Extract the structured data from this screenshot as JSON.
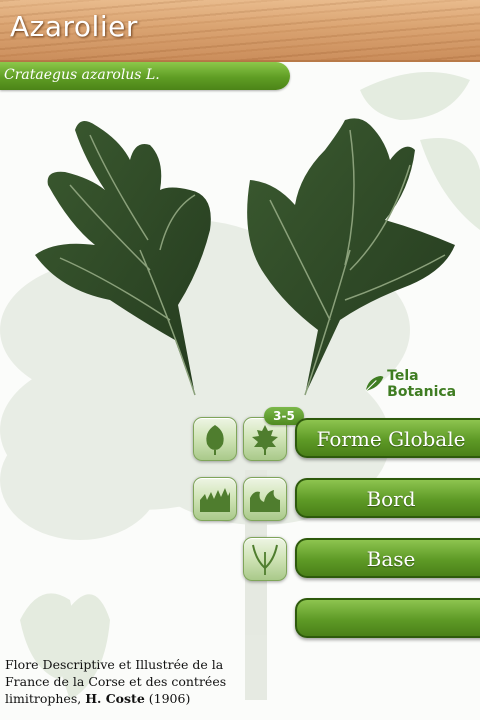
{
  "header": {
    "title": "Azarolier"
  },
  "species": {
    "scientific_name": "Crataegus azarolus L."
  },
  "logo": {
    "text": "Tela Botanica"
  },
  "criteria": {
    "badge": "3-5",
    "buttons": [
      {
        "label": "Forme Globale"
      },
      {
        "label": "Bord"
      },
      {
        "label": "Base"
      },
      {
        "label": ""
      }
    ]
  },
  "credit": {
    "text": "Flore Descriptive et Illustrée de la France de la Corse et des contrées limitrophes,",
    "author": "H. Coste",
    "year": "(1906)"
  },
  "colors": {
    "accent_green": "#5e9a26",
    "header_wood": "#d9a16e",
    "leaf_dark": "#2f4a26"
  }
}
